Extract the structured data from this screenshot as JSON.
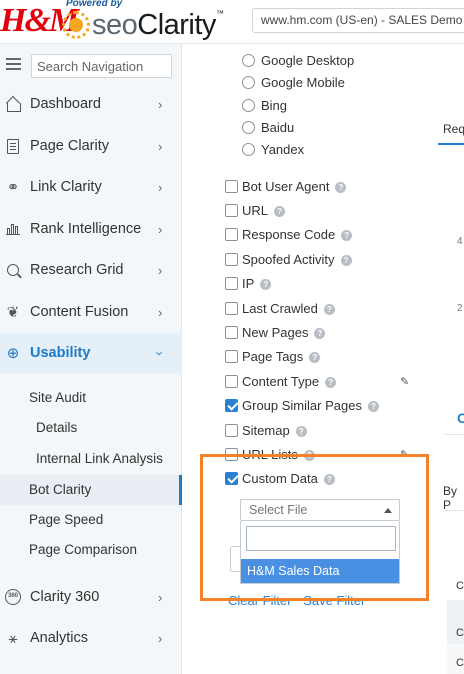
{
  "header": {
    "brand_logo": "H&M",
    "powered_by": "Powered by",
    "product_prefix": "seo",
    "product_suffix": "Clarity",
    "trademark": "™",
    "site_selector": "www.hm.com (US-en) - SALES Demo"
  },
  "sidebar": {
    "search_placeholder": "Search Navigation",
    "items": [
      {
        "label": "Dashboard",
        "icon": "house-icon"
      },
      {
        "label": "Page Clarity",
        "icon": "page-icon"
      },
      {
        "label": "Link Clarity",
        "icon": "link-icon"
      },
      {
        "label": "Rank Intelligence",
        "icon": "bar-chart-icon"
      },
      {
        "label": "Research Grid",
        "icon": "search-icon"
      },
      {
        "label": "Content Fusion",
        "icon": "brain-icon"
      },
      {
        "label": "Usability",
        "icon": "usability-icon"
      },
      {
        "label": "Clarity 360",
        "icon": "clarity-360-icon"
      },
      {
        "label": "Analytics",
        "icon": "analytics-icon"
      }
    ],
    "usability_sub": [
      {
        "label": "Site Audit"
      },
      {
        "label": "Details"
      },
      {
        "label": "Internal Link Analysis"
      },
      {
        "label": "Bot Clarity"
      },
      {
        "label": "Page Speed"
      },
      {
        "label": "Page Comparison"
      }
    ]
  },
  "filters": {
    "search_engines": [
      "Google Desktop",
      "Google Mobile",
      "Bing",
      "Baidu",
      "Yandex"
    ],
    "options": [
      {
        "label": "Bot User Agent",
        "checked": false
      },
      {
        "label": "URL",
        "checked": false
      },
      {
        "label": "Response Code",
        "checked": false
      },
      {
        "label": "Spoofed Activity",
        "checked": false
      },
      {
        "label": "IP",
        "checked": false
      },
      {
        "label": "Last Crawled",
        "checked": false
      },
      {
        "label": "New Pages",
        "checked": false
      },
      {
        "label": "Page Tags",
        "checked": false
      },
      {
        "label": "Content Type",
        "checked": false
      },
      {
        "label": "Group Similar Pages",
        "checked": true
      },
      {
        "label": "Sitemap",
        "checked": false
      },
      {
        "label": "URL Lists",
        "checked": false
      },
      {
        "label": "Custom Data",
        "checked": true
      }
    ],
    "select_file_placeholder": "Select File",
    "dropdown_search_value": "",
    "dropdown_option": "H&M Sales Data",
    "clear_filter": "Clear Filter",
    "save_filter": "Save Filter",
    "help_glyph": "?"
  },
  "right_panel": {
    "tab_label": "Req",
    "num_1": "4",
    "num_2": "2",
    "section_letter": "C",
    "group_label": "By P",
    "col_header": "Co",
    "row_1": "C",
    "row_2": "C"
  },
  "colors": {
    "accent": "#1f7ac4",
    "highlight": "#f5822a",
    "brand_red": "#e50010",
    "selected_option": "#4a90e2"
  }
}
